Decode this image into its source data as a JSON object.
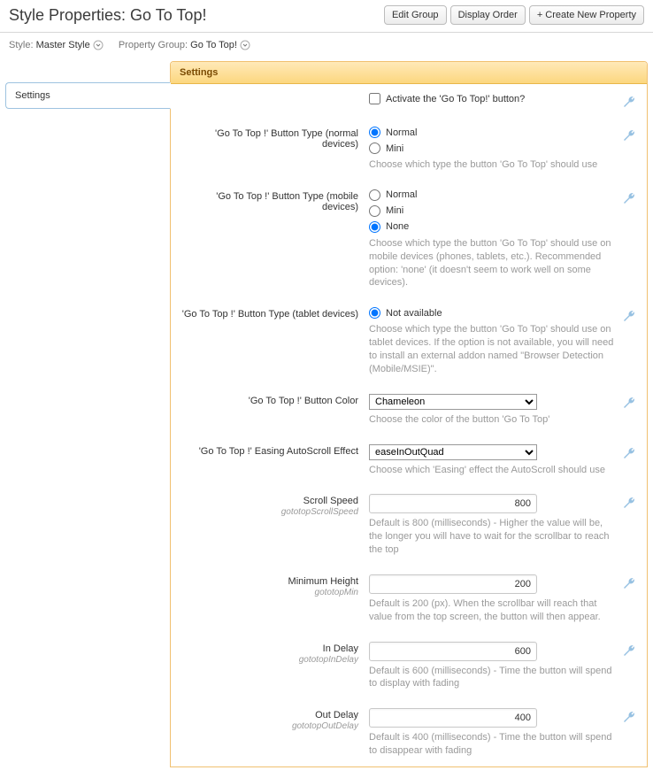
{
  "header": {
    "title": "Style Properties: Go To Top!",
    "buttons": {
      "edit": "Edit Group",
      "order": "Display Order",
      "create": "+ Create New Property"
    }
  },
  "sub": {
    "style_lbl": "Style:",
    "style_val": "Master Style",
    "group_lbl": "Property Group:",
    "group_val": "Go To Top!"
  },
  "sidebar": {
    "tab": "Settings"
  },
  "panel_title": "Settings",
  "activate_label": "Activate the 'Go To Top!' button?",
  "normal_type": {
    "label": "'Go To Top !' Button Type (normal devices)",
    "opt1": "Normal",
    "opt2": "Mini",
    "hint": "Choose which type the button 'Go To Top' should use"
  },
  "mobile_type": {
    "label": "'Go To Top !' Button Type (mobile devices)",
    "opt1": "Normal",
    "opt2": "Mini",
    "opt3": "None",
    "hint": "Choose which type the button 'Go To Top' should use on mobile devices (phones, tablets, etc.). Recommended option: 'none' (it doesn't seem to work well on some devices)."
  },
  "tablet_type": {
    "label": "'Go To Top !' Button Type (tablet devices)",
    "opt1": "Not available",
    "hint": "Choose which type the button 'Go To Top' should use on tablet devices. If the option is not available, you will need to install an external addon named \"Browser Detection (Mobile/MSIE)\"."
  },
  "color": {
    "label": "'Go To Top !' Button Color",
    "value": "Chameleon",
    "hint": "Choose the color of the button 'Go To Top'"
  },
  "easing": {
    "label": "'Go To Top !' Easing AutoScroll Effect",
    "value": "easeInOutQuad",
    "hint": "Choose which 'Easing' effect the AutoScroll should use"
  },
  "speed": {
    "label": "Scroll Speed",
    "tech": "gototopScrollSpeed",
    "value": "800",
    "hint": "Default is 800 (milliseconds) - Higher the value will be, the longer you will have to wait for the scrollbar to reach the top"
  },
  "minh": {
    "label": "Minimum Height",
    "tech": "gototopMin",
    "value": "200",
    "hint": "Default is 200 (px). When the scrollbar will reach that value from the top screen, the button will then appear."
  },
  "indelay": {
    "label": "In Delay",
    "tech": "gototopInDelay",
    "value": "600",
    "hint": "Default is 600 (milliseconds) - Time the button will spend to display with fading"
  },
  "outdelay": {
    "label": "Out Delay",
    "tech": "gototopOutDelay",
    "value": "400",
    "hint": "Default is 400 (milliseconds) - Time the button will spend to disappear with fading"
  }
}
